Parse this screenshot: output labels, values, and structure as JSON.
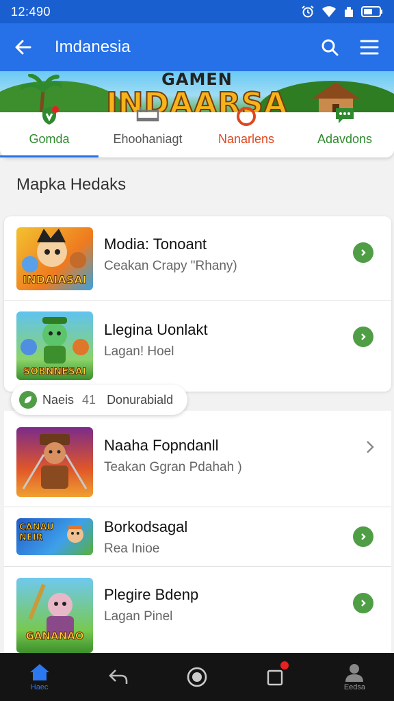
{
  "status_bar": {
    "time": "12:490"
  },
  "app_bar": {
    "title": "Imdanesia"
  },
  "banner": {
    "small_text": "GAMEN",
    "big_text": "INDAARSA"
  },
  "tabs": [
    {
      "label": "Gomda",
      "color": "#2f8a2f",
      "icon": "shield-icon",
      "active": true
    },
    {
      "label": "Ehoohaniagt",
      "color": "#555555",
      "icon": "monitor-icon",
      "active": false
    },
    {
      "label": "Nanarlens",
      "color": "#e0461e",
      "icon": "ring-icon",
      "active": false
    },
    {
      "label": "Adavdons",
      "color": "#2f8a2f",
      "icon": "chat-icon",
      "active": false
    }
  ],
  "section": {
    "title": "Mapka Hedaks"
  },
  "games": [
    {
      "name": "Modia: Tonoant",
      "subtitle": "Ceakan Crapy \"Rhany)",
      "thumb_text": "INDAIASAI",
      "action": "go"
    },
    {
      "name": "Llegina Uonlakt",
      "subtitle": "Lagan! Hoel",
      "thumb_text": "SOBNNESAI",
      "action": "go"
    },
    {
      "name": "Naaha Fopndanll",
      "subtitle": "Teakan Ggran Pdahah )",
      "thumb_text": "",
      "action": "chevron"
    },
    {
      "name": "Borkodsagal",
      "subtitle": "Rea Inioe",
      "thumb_text": "CANAU NEIR",
      "action": "go"
    },
    {
      "name": "Plegire Bdenp",
      "subtitle": "Lagan Pinel",
      "thumb_text": "GANANAO",
      "action": "go"
    }
  ],
  "chip": {
    "part1": "Naeis",
    "part2": "41",
    "part3": "Donurabiald"
  },
  "bottom_nav": [
    {
      "label": "Haec",
      "icon": "home-icon",
      "active": true
    },
    {
      "label": "",
      "icon": "back-arrow-icon",
      "active": false
    },
    {
      "label": "",
      "icon": "circle-home-icon",
      "active": false
    },
    {
      "label": "",
      "icon": "recents-icon",
      "active": false,
      "badge": true
    },
    {
      "label": "Eedsa",
      "icon": "profile-icon",
      "active": false
    }
  ]
}
